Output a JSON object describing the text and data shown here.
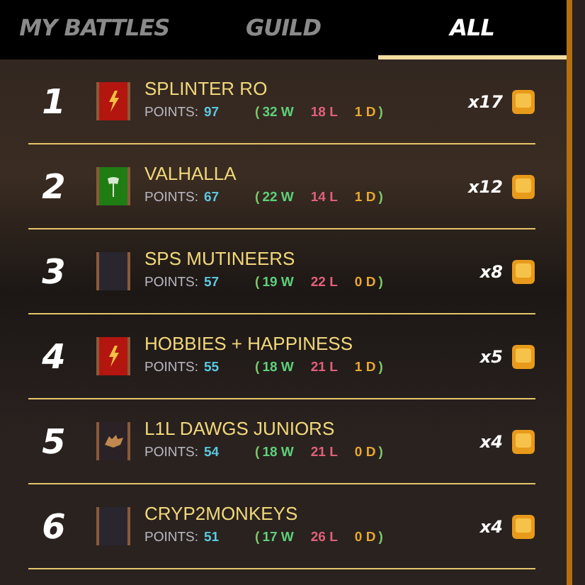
{
  "tabs": [
    {
      "label": "MY BATTLES",
      "selected": false
    },
    {
      "label": "GUILD",
      "selected": false
    },
    {
      "label": "ALL",
      "selected": true
    }
  ],
  "rows": [
    {
      "rank": "1",
      "color": "#b3160f",
      "kind": "lightning",
      "name": "SPLINTER RO",
      "points_label": "POINTS:",
      "points": "97",
      "open": "(",
      "wins": "32 W",
      "losses": "18 L",
      "draws": "1 D",
      "close": ")",
      "reward": "x17"
    },
    {
      "rank": "2",
      "color": "#1f7d14",
      "kind": "axe",
      "name": "VALHALLA",
      "points_label": "POINTS:",
      "points": "67",
      "open": "(",
      "wins": "22 W",
      "losses": "14 L",
      "draws": "1 D",
      "close": ")",
      "reward": "x12"
    },
    {
      "rank": "3",
      "color": "#2a2630",
      "kind": "plain",
      "name": "SPS MUTINEERS",
      "points_label": "POINTS:",
      "points": "57",
      "open": "(",
      "wins": "19 W",
      "losses": "22 L",
      "draws": "0 D",
      "close": ")",
      "reward": "x8"
    },
    {
      "rank": "4",
      "color": "#b3160f",
      "kind": "lightning",
      "name": "HOBBIES + HAPPINESS",
      "points_label": "POINTS:",
      "points": "55",
      "open": "(",
      "wins": "18 W",
      "losses": "21 L",
      "draws": "1 D",
      "close": ")",
      "reward": "x5"
    },
    {
      "rank": "5",
      "color": "#2a2226",
      "kind": "wolf",
      "name": "L1L DAWGS JUNIORS",
      "points_label": "POINTS:",
      "points": "54",
      "open": "(",
      "wins": "18 W",
      "losses": "21 L",
      "draws": "0 D",
      "close": ")",
      "reward": "x4"
    },
    {
      "rank": "6",
      "color": "#2a2630",
      "kind": "plain",
      "name": "CRYP2MONKEYS",
      "points_label": "POINTS:",
      "points": "51",
      "open": "(",
      "wins": "17 W",
      "losses": "26 L",
      "draws": "0 D",
      "close": ")",
      "reward": "x4"
    }
  ]
}
